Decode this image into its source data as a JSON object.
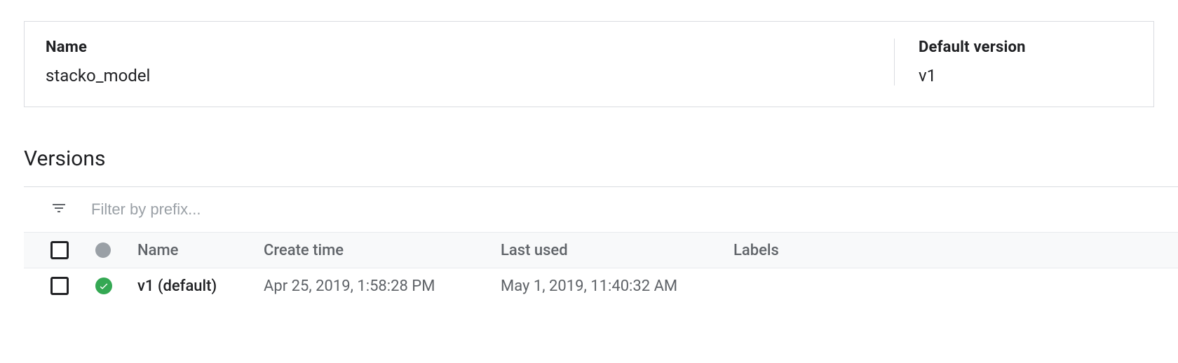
{
  "info": {
    "name_label": "Name",
    "name_value": "stacko_model",
    "default_label": "Default version",
    "default_value": "v1"
  },
  "section": {
    "title": "Versions",
    "filter_placeholder": "Filter by prefix..."
  },
  "table": {
    "headers": {
      "name": "Name",
      "create_time": "Create time",
      "last_used": "Last used",
      "labels": "Labels"
    },
    "rows": [
      {
        "name": "v1 (default)",
        "create_time": "Apr 25, 2019, 1:58:28 PM",
        "last_used": "May 1, 2019, 11:40:32 AM",
        "labels": ""
      }
    ]
  }
}
